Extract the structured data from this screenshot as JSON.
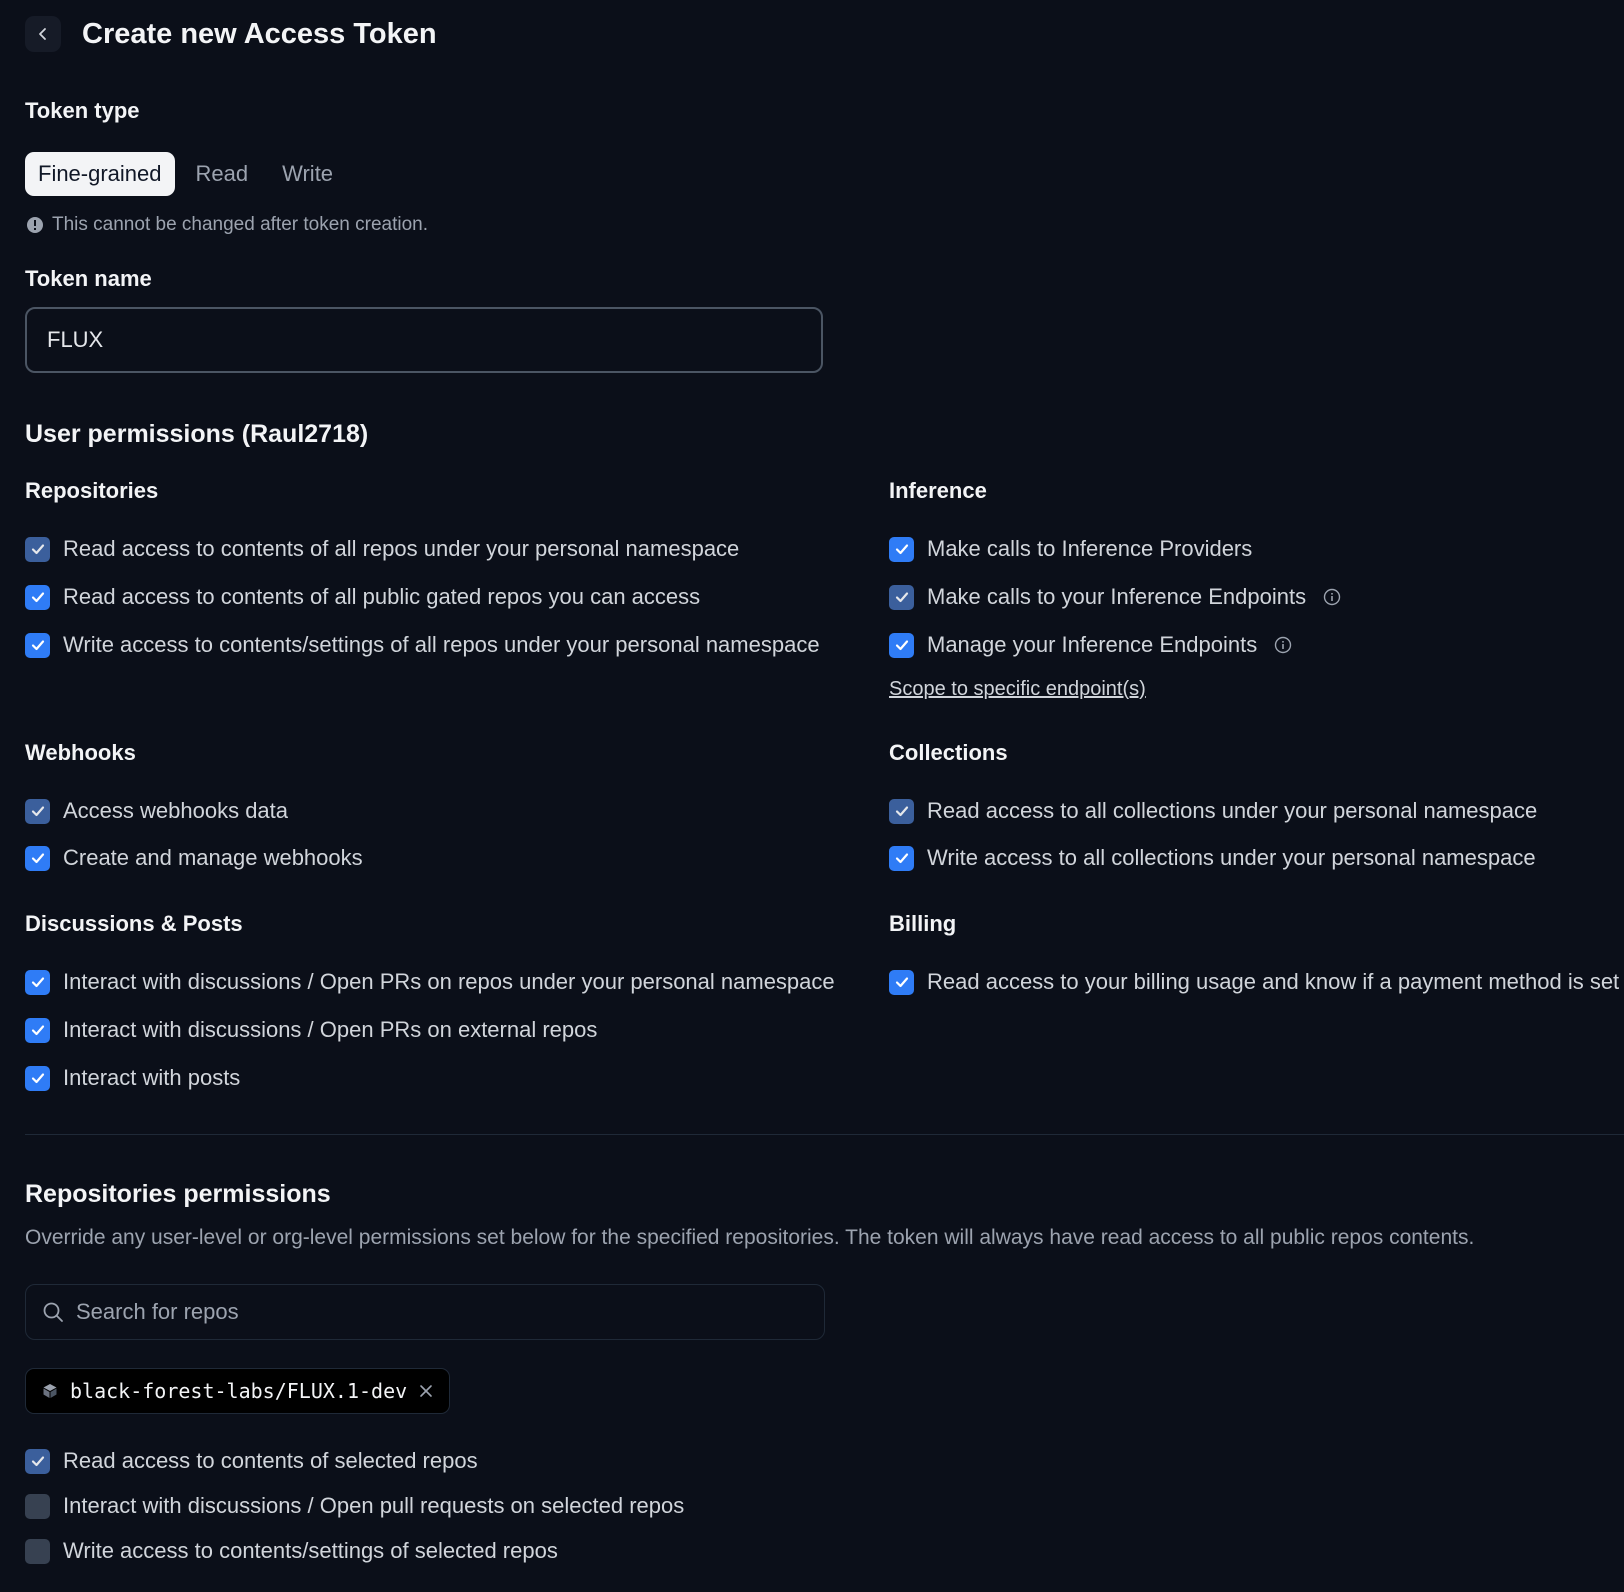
{
  "header": {
    "title": "Create new Access Token"
  },
  "token_type": {
    "label": "Token type",
    "options": [
      "Fine-grained",
      "Read",
      "Write"
    ],
    "selected": "Fine-grained",
    "note": "This cannot be changed after token creation."
  },
  "token_name": {
    "label": "Token name",
    "value": "FLUX"
  },
  "user_permissions": {
    "title": "User permissions (Raul2718)",
    "repositories": {
      "title": "Repositories",
      "items": [
        {
          "label": "Read access to contents of all repos under your personal namespace",
          "checked": true
        },
        {
          "label": "Read access to contents of all public gated repos you can access",
          "checked": true
        },
        {
          "label": "Write access to contents/settings of all repos under your personal namespace",
          "checked": true
        }
      ]
    },
    "inference": {
      "title": "Inference",
      "items": [
        {
          "label": "Make calls to Inference Providers",
          "checked": true
        },
        {
          "label": "Make calls to your Inference Endpoints",
          "checked": true
        },
        {
          "label": "Manage your Inference Endpoints",
          "checked": true
        }
      ],
      "scope_link": "Scope to specific endpoint(s)"
    },
    "webhooks": {
      "title": "Webhooks",
      "items": [
        {
          "label": "Access webhooks data",
          "checked": true
        },
        {
          "label": "Create and manage webhooks",
          "checked": true
        }
      ]
    },
    "collections": {
      "title": "Collections",
      "items": [
        {
          "label": "Read access to all collections under your personal namespace",
          "checked": true
        },
        {
          "label": "Write access to all collections under your personal namespace",
          "checked": true
        }
      ]
    },
    "discussions": {
      "title": "Discussions & Posts",
      "items": [
        {
          "label": "Interact with discussions / Open PRs on repos under your personal namespace",
          "checked": true
        },
        {
          "label": "Interact with discussions / Open PRs on external repos",
          "checked": true
        },
        {
          "label": "Interact with posts",
          "checked": true
        }
      ]
    },
    "billing": {
      "title": "Billing",
      "items": [
        {
          "label": "Read access to your billing usage and know if a payment method is set",
          "checked": true
        }
      ]
    }
  },
  "repo_permissions": {
    "title": "Repositories permissions",
    "description": "Override any user-level or org-level permissions set below for the specified repositories. The token will always have read access to all public repos contents.",
    "search_placeholder": "Search for repos",
    "selected_repo": "black-forest-labs/FLUX.1-dev",
    "items": [
      {
        "label": "Read access to contents of selected repos",
        "checked": true
      },
      {
        "label": "Interact with discussions / Open pull requests on selected repos",
        "checked": false
      },
      {
        "label": "Write access to contents/settings of selected repos",
        "checked": false
      }
    ]
  },
  "colors": {
    "background": "#0b0f19",
    "checkbox_accent": "#2f7cf6",
    "chip_background": "#000000"
  }
}
